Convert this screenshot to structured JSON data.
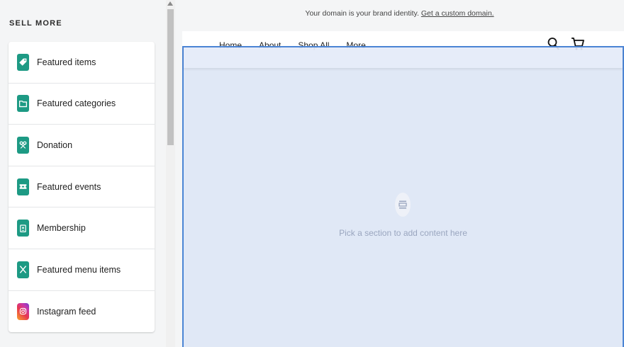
{
  "sidebar": {
    "section_title": "SELL MORE",
    "items": [
      {
        "label": "Featured items",
        "icon": "tag-icon"
      },
      {
        "label": "Featured categories",
        "icon": "folder-icon"
      },
      {
        "label": "Donation",
        "icon": "ribbon-icon"
      },
      {
        "label": "Featured events",
        "icon": "ticket-icon"
      },
      {
        "label": "Membership",
        "icon": "badge-icon"
      },
      {
        "label": "Featured menu items",
        "icon": "utensils-icon"
      },
      {
        "label": "Instagram feed",
        "icon": "instagram-icon"
      }
    ],
    "accent_color": "#1d9a84"
  },
  "banner": {
    "text": "Your domain is your brand identity.",
    "link": "Get a custom domain."
  },
  "site_nav": {
    "links": [
      "Home",
      "About",
      "Shop All",
      "More"
    ],
    "search_icon": "search-icon",
    "cart_icon": "cart-icon"
  },
  "placeholder": {
    "text": "Pick a section to add content here",
    "icon": "section-icon"
  },
  "colors": {
    "selection_border": "#4b84d4",
    "overlay": "#dfe6f4"
  }
}
